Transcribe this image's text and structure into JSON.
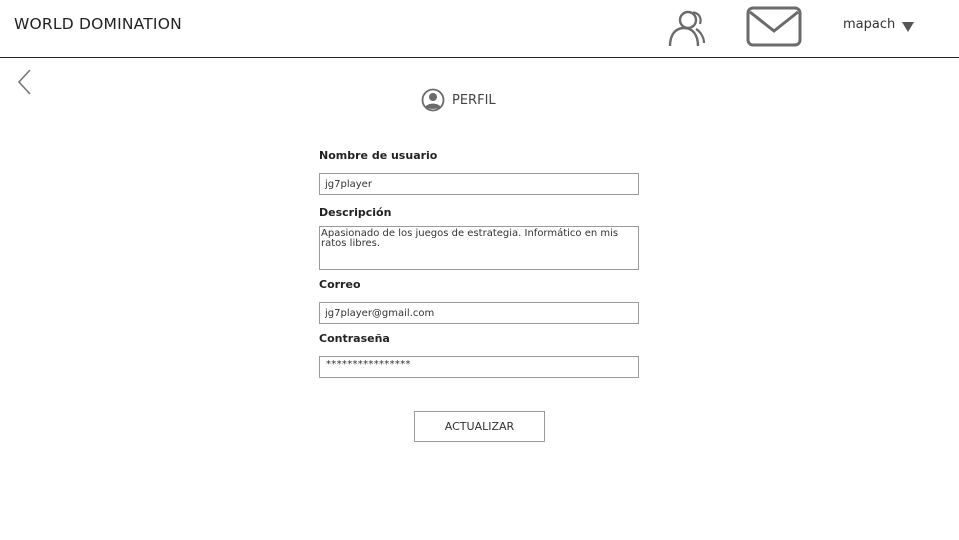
{
  "header": {
    "app_title": "WORLD DOMINATION",
    "username": "mapach"
  },
  "page": {
    "title": "PERFIL"
  },
  "form": {
    "username_label": "Nombre de usuario",
    "username_value": "jg7player",
    "description_label": "Descripción",
    "description_value": "Apasionado de los juegos de estrategia. Informático en mis ratos libres.",
    "email_label": "Correo",
    "email_value": "jg7player@gmail.com",
    "password_label": "Contraseña",
    "password_value": "****************",
    "submit_label": "ACTUALIZAR"
  },
  "icons": {
    "friends": "users-icon",
    "messages": "mail-icon",
    "menu": "caret-down-icon",
    "back": "chevron-left-icon",
    "profile": "user-circle-icon"
  },
  "colors": {
    "icon_gray": "#6b6b6b",
    "border": "#9a9a9a",
    "text": "#333333"
  }
}
